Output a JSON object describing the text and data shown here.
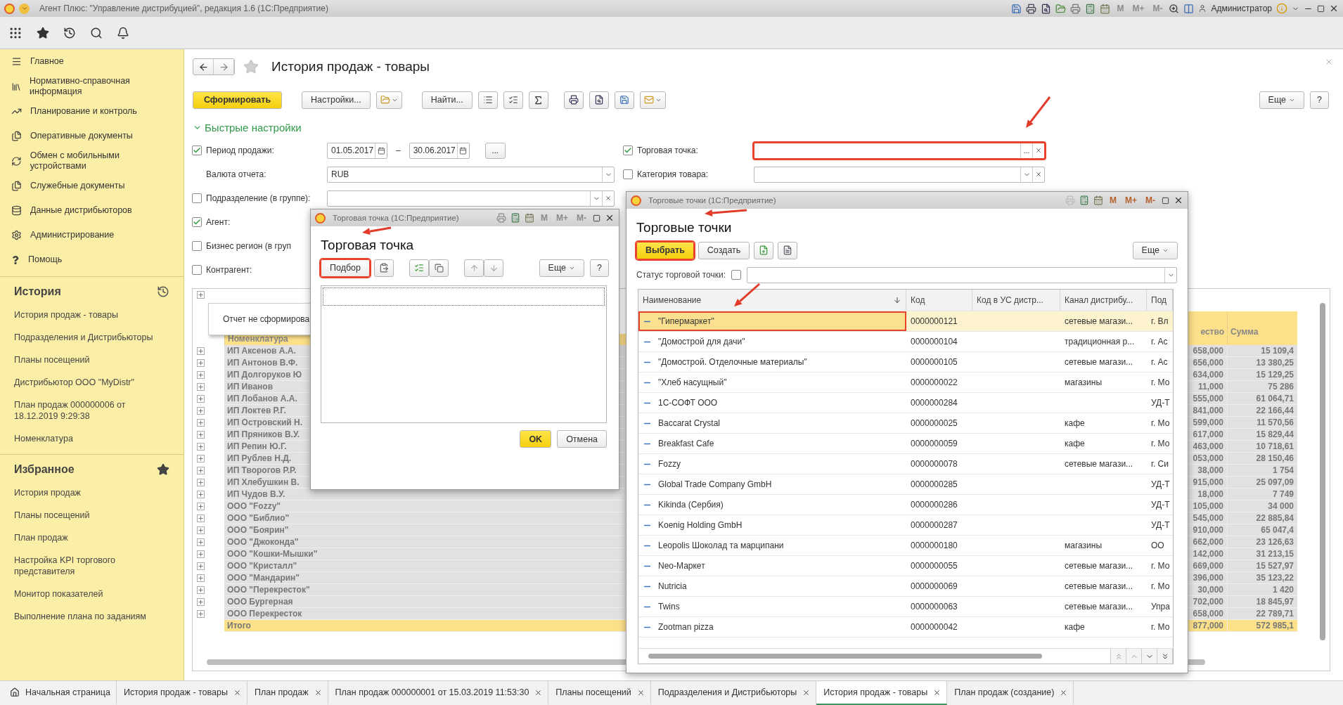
{
  "window": {
    "title": "Агент Плюс: \"Управление дистрибуцией\", редакция 1.6  (1С:Предприятие)",
    "user": "Администратор",
    "memory_buttons": [
      "M",
      "M+",
      "M-"
    ],
    "memory_enabled": false
  },
  "sidebar": {
    "sections": [
      "Главное",
      "Нормативно-справочная информация",
      "Планирование и контроль",
      "Оперативные документы",
      "Обмен с мобильными устройствами",
      "Служебные документы",
      "Данные дистрибьюторов",
      "Администрирование",
      "Помощь"
    ],
    "history": {
      "title": "История",
      "items": [
        "История продаж - товары",
        "Подразделения и Дистрибьюторы",
        "Планы посещений",
        "Дистрибьютор ООО \"MyDistr\"",
        "План продаж 000000006 от 18.12.2019 9:29:38",
        "Номенклатура"
      ]
    },
    "favorites": {
      "title": "Избранное",
      "items": [
        "История продаж",
        "Планы посещений",
        "План продаж",
        "Настройка KPI торгового представителя",
        "Монитор показателей",
        "Выполнение плана по заданиям"
      ]
    }
  },
  "page": {
    "title": "История продаж - товары",
    "buttons": {
      "generate": "Сформировать",
      "settings": "Настройки...",
      "find": "Найти...",
      "more": "Еще",
      "help": "?"
    },
    "quick_settings": {
      "title": "Быстрые настройки",
      "expanded": true,
      "left": [
        {
          "kind": "period",
          "label": "Период продажи:",
          "checked": true,
          "from": "01.05.2017",
          "separator": "–",
          "to": "30.06.2017",
          "more": "..."
        },
        {
          "kind": "select",
          "label": "Валюта отчета:",
          "value": "RUB",
          "clearable": false
        },
        {
          "kind": "select",
          "label": "Подразделение (в группе):",
          "checked": false,
          "clearable": true
        },
        {
          "kind": "hidden",
          "label": "Агент:",
          "checked": true
        },
        {
          "kind": "hidden",
          "label": "Бизнес регион (в груп",
          "checked": false
        },
        {
          "kind": "hidden",
          "label": "Контрагент:",
          "checked": false
        }
      ],
      "right": [
        {
          "kind": "choice",
          "label": "Торговая точка:",
          "checked": true,
          "highlighted": true,
          "more": "..."
        },
        {
          "kind": "select",
          "label": "Категория товара:",
          "checked": false,
          "clearable": true
        }
      ]
    },
    "report": {
      "message": "Отчет не сформирова",
      "columns": [
        "Номенклатура",
        "ество",
        "Сумма"
      ],
      "rows": [
        {
          "name": "ИП Аксенов А.А.",
          "qty": "658,000",
          "sum": "15 109,4"
        },
        {
          "name": "ИП Антонов В.Ф.",
          "qty": "656,000",
          "sum": "13 380,25"
        },
        {
          "name": "ИП Долгоруков Ю",
          "qty": "634,000",
          "sum": "15 129,25"
        },
        {
          "name": "ИП Иванов",
          "qty": "11,000",
          "sum": "75 286"
        },
        {
          "name": "ИП Лобанов А.А.",
          "qty": "555,000",
          "sum": "61 064,71"
        },
        {
          "name": "ИП Локтев Р.Г.",
          "qty": "841,000",
          "sum": "22 166,44"
        },
        {
          "name": "ИП Островский Н.",
          "qty": "599,000",
          "sum": "11 570,56"
        },
        {
          "name": "ИП Пряников В.У.",
          "qty": "617,000",
          "sum": "15 829,44"
        },
        {
          "name": "ИП Репин Ю.Г.",
          "qty": "463,000",
          "sum": "10 718,61"
        },
        {
          "name": "ИП Рублев Н.Д.",
          "qty": "053,000",
          "sum": "28 150,46"
        },
        {
          "name": "ИП Творогов Р.Р.",
          "qty": "38,000",
          "sum": "1 754"
        },
        {
          "name": "ИП Хлебушкин В.",
          "qty": "915,000",
          "sum": "25 097,09"
        },
        {
          "name": "ИП Чудов В.У.",
          "qty": "18,000",
          "sum": "7 749"
        },
        {
          "name": "ООО \"Fozzy\"",
          "qty": "105,000",
          "sum": "34 000"
        },
        {
          "name": "ООО \"Библио\"",
          "qty": "545,000",
          "sum": "22 885,84"
        },
        {
          "name": "ООО \"Боярин\"",
          "qty": "910,000",
          "sum": "65 047,4"
        },
        {
          "name": "ООО \"Джоконда\"",
          "qty": "662,000",
          "sum": "23 126,63"
        },
        {
          "name": "ООО \"Кошки-Мышки\"",
          "qty": "142,000",
          "sum": "31 213,15"
        },
        {
          "name": "ООО \"Кристалл\"",
          "qty": "669,000",
          "sum": "15 527,97"
        },
        {
          "name": "ООО \"Мандарин\"",
          "qty": "396,000",
          "sum": "35 123,22"
        },
        {
          "name": "ООО \"Перекресток\"",
          "qty": "30,000",
          "sum": "1 420"
        },
        {
          "name": "ООО Бургерная",
          "qty": "702,000",
          "sum": "18 845,97"
        },
        {
          "name": "ООО Перекресток",
          "qty": "658,000",
          "sum": "22 789,71"
        }
      ],
      "total": {
        "name": "Итого",
        "qty": "877,000",
        "sum": "572 985,1"
      }
    }
  },
  "outlet_dialog": {
    "title": "Торговая точка  (1С:Предприятие)",
    "memory_buttons": [
      "M",
      "M+",
      "M-"
    ],
    "memory_enabled": false,
    "heading": "Торговая точка",
    "pick": "Подбор",
    "pick_highlighted": true,
    "more": "Еще",
    "help": "?",
    "ok": "OK",
    "cancel": "Отмена"
  },
  "outlets_dialog": {
    "title": "Торговые точки  (1С:Предприятие)",
    "memory_buttons": [
      "M",
      "M+",
      "M-"
    ],
    "memory_enabled": true,
    "heading": "Торговые точки",
    "choose": "Выбрать",
    "choose_highlighted": true,
    "create": "Создать",
    "more": "Еще",
    "filter": {
      "label": "Статус торговой точки:",
      "checked": false
    },
    "columns": [
      {
        "label": "Наименование",
        "sorted": true
      },
      {
        "label": "Код",
        "sorted": false
      },
      {
        "label": "Код в УС дистр...",
        "sorted": false
      },
      {
        "label": "Канал дистрибу...",
        "sorted": false
      },
      {
        "label": "Под",
        "sorted": false
      }
    ],
    "rows": [
      {
        "name": "\"Гипермаркет\"",
        "code": "0000000121",
        "channel": "сетевые магази...",
        "column_5": "г. Вл",
        "selected": true,
        "highlighted": true
      },
      {
        "name": "\"Домострой для дачи\"",
        "code": "0000000104",
        "channel": "традиционная р...",
        "column_5": "г. Ас",
        "selected": false,
        "highlighted": false
      },
      {
        "name": "\"Домострой. Отделочные материалы\"",
        "code": "0000000105",
        "channel": "сетевые магази...",
        "column_5": "г. Ас",
        "selected": false,
        "highlighted": false
      },
      {
        "name": "\"Хлеб насущный\"",
        "code": "0000000022",
        "channel": "магазины",
        "column_5": "г. Мо",
        "selected": false,
        "highlighted": false
      },
      {
        "name": "1С-СОФТ ООО",
        "code": "0000000284",
        "column_5": "УД-Т",
        "selected": false,
        "highlighted": false
      },
      {
        "name": "Baccarat Crystal",
        "code": "0000000025",
        "channel": "кафе",
        "column_5": "г. Мо",
        "selected": false,
        "highlighted": false
      },
      {
        "name": "Breakfast Cafe",
        "code": "0000000059",
        "channel": "кафе",
        "column_5": "г. Мо",
        "selected": false,
        "highlighted": false
      },
      {
        "name": "Fozzy",
        "code": "0000000078",
        "channel": "сетевые магази...",
        "column_5": "г. Си",
        "selected": false,
        "highlighted": false
      },
      {
        "name": "Global Trade Company GmbH",
        "code": "0000000285",
        "column_5": "УД-Т",
        "selected": false,
        "highlighted": false
      },
      {
        "name": "Kikinda (Сербия)",
        "code": "0000000286",
        "column_5": "УД-Т",
        "selected": false,
        "highlighted": false
      },
      {
        "name": "Koenig Holding GmbH",
        "code": "0000000287",
        "column_5": "УД-Т",
        "selected": false,
        "highlighted": false
      },
      {
        "name": "Leopolis Шоколад та марципани",
        "code": "0000000180",
        "channel": "магазины",
        "column_5": "ОО",
        "selected": false,
        "highlighted": false
      },
      {
        "name": "Neo-Маркет",
        "code": "0000000055",
        "channel": "сетевые магази...",
        "column_5": "г. Мо",
        "selected": false,
        "highlighted": false
      },
      {
        "name": "Nutricia",
        "code": "0000000069",
        "channel": "сетевые магази...",
        "column_5": "г. Мо",
        "selected": false,
        "highlighted": false
      },
      {
        "name": "Twins",
        "code": "0000000063",
        "channel": "сетевые магази...",
        "column_5": "Упра",
        "selected": false,
        "highlighted": false
      },
      {
        "name": "Zootman pizza",
        "code": "0000000042",
        "channel": "кафе",
        "column_5": "г. Мо",
        "selected": false,
        "highlighted": false
      }
    ]
  },
  "tabs": [
    {
      "label": "Начальная страница",
      "kind": "home",
      "selected": false
    },
    {
      "label": "История продаж - товары",
      "kind": "page",
      "selected": false
    },
    {
      "label": "План продаж",
      "kind": "page",
      "selected": false
    },
    {
      "label": "План продаж 000000001 от 15.03.2019 11:53:30",
      "kind": "page",
      "selected": false
    },
    {
      "label": "Планы посещений",
      "kind": "page",
      "selected": false
    },
    {
      "label": "Подразделения и Дистрибьюторы",
      "kind": "page",
      "selected": false
    },
    {
      "label": "История продаж - товары",
      "kind": "page",
      "selected": true
    },
    {
      "label": "План продаж (создание)",
      "kind": "page",
      "selected": false
    }
  ]
}
